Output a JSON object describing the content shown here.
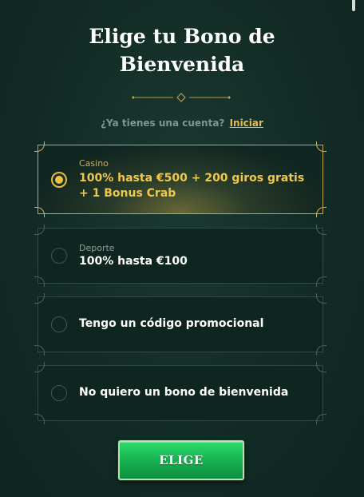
{
  "header": {
    "title_line1": "Elige tu Bono de",
    "title_line2": "Bienvenida"
  },
  "login": {
    "question": "¿Ya tienes una cuenta?",
    "link_label": "Iniciar"
  },
  "options": [
    {
      "category": "Casino",
      "label": "100% hasta €500 + 200 giros gratis + 1 Bonus Crab",
      "selected": true
    },
    {
      "category": "Deporte",
      "label": "100% hasta €100",
      "selected": false
    },
    {
      "category": "",
      "label": "Tengo un código promocional",
      "selected": false
    },
    {
      "category": "",
      "label": "No quiero un bono de bienvenida",
      "selected": false
    }
  ],
  "cta": {
    "label": "ELIGE"
  },
  "icons": {
    "ornament": "divider-diamond-icon",
    "radio_selected": "radio-checked-icon",
    "radio_unselected": "radio-unchecked-icon"
  },
  "colors": {
    "background": "#122b25",
    "accent_gold": "#e6bc4d",
    "cta_green": "#19b553",
    "text_muted": "#7e9690"
  }
}
